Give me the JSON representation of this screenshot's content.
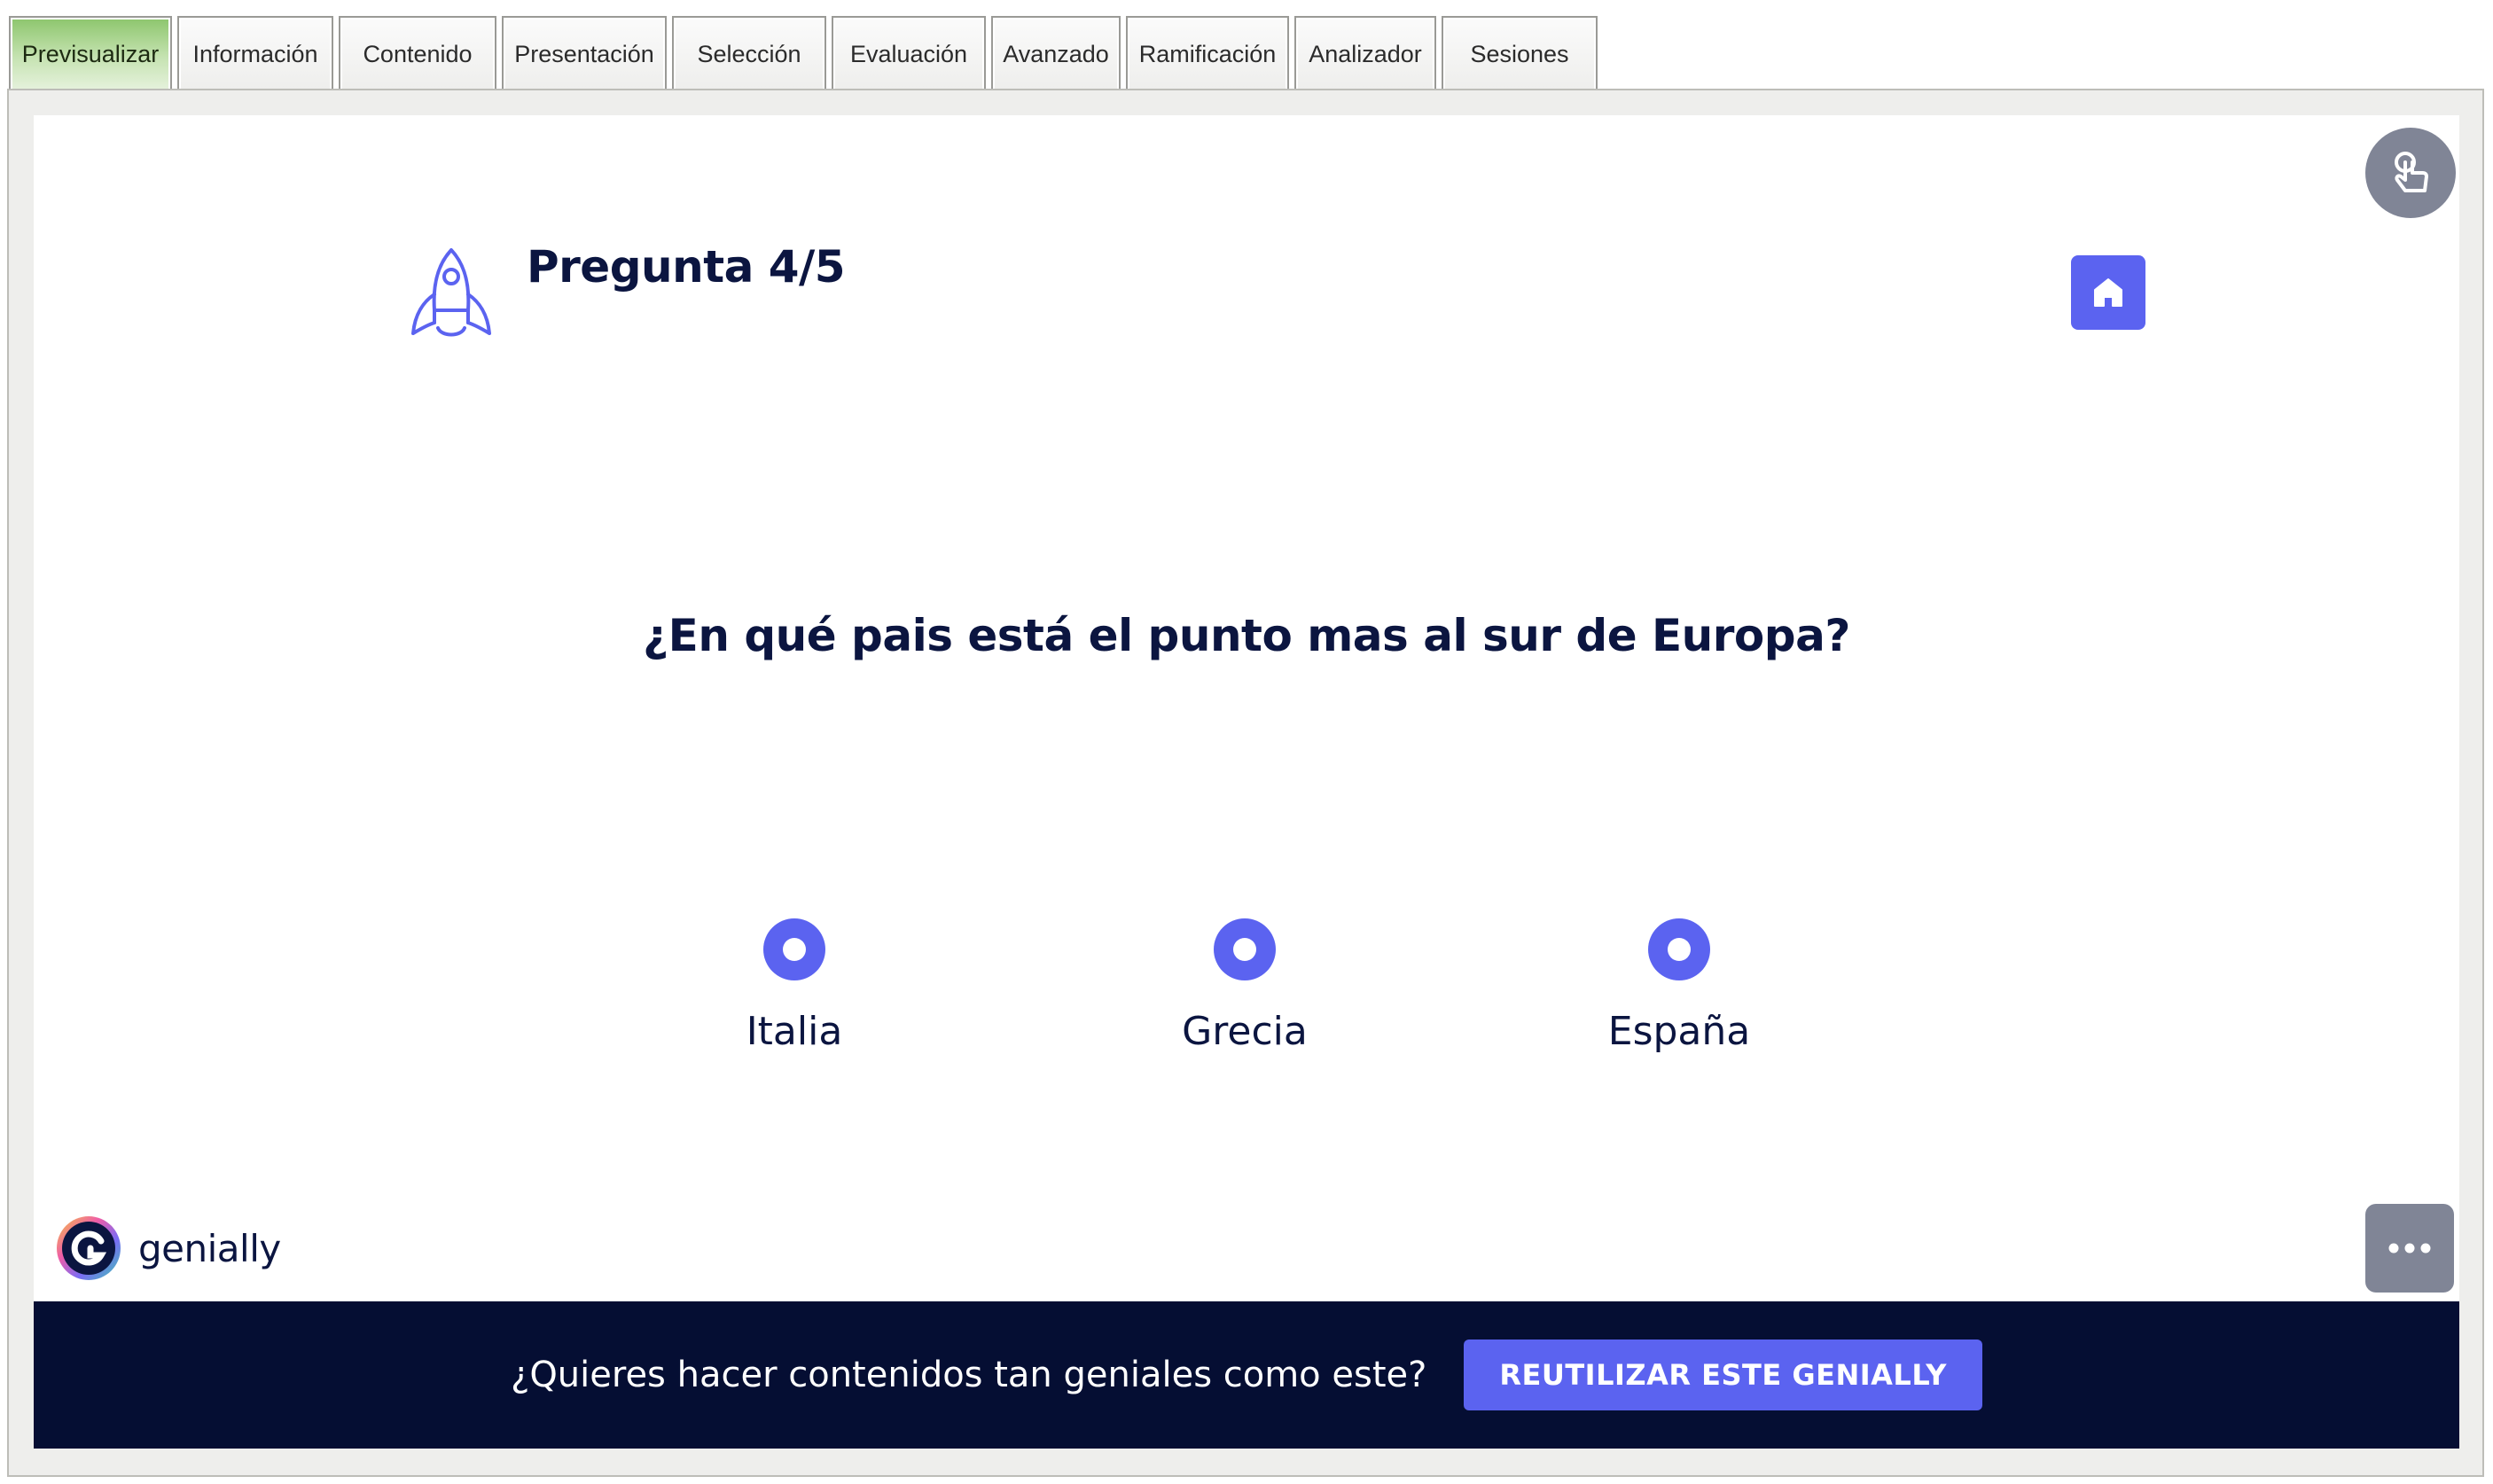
{
  "tabs": [
    {
      "label": "Previsualizar",
      "active": true
    },
    {
      "label": "Información",
      "active": false
    },
    {
      "label": "Contenido",
      "active": false
    },
    {
      "label": "Presentación",
      "active": false
    },
    {
      "label": "Selección",
      "active": false
    },
    {
      "label": "Evaluación",
      "active": false
    },
    {
      "label": "Avanzado",
      "active": false
    },
    {
      "label": "Ramificación",
      "active": false
    },
    {
      "label": "Analizador",
      "active": false
    },
    {
      "label": "Sesiones",
      "active": false
    }
  ],
  "quiz": {
    "counter": "Pregunta 4/5",
    "question": "¿En qué pais está el punto mas al sur de Europa?",
    "answers": [
      {
        "label": "Italia"
      },
      {
        "label": "Grecia"
      },
      {
        "label": "España"
      }
    ]
  },
  "icons": {
    "header": "rocket-icon",
    "home": "home-icon",
    "pointer": "hand-pointer-icon",
    "more": "more-dots-icon"
  },
  "brand": {
    "name": "genially"
  },
  "promo": {
    "text": "¿Quieres hacer contenidos tan geniales como este?",
    "button": "REUTILIZAR ESTE GENIALLY"
  },
  "colors": {
    "accent": "#5b63f0",
    "text_dark": "#0b1540",
    "footer_bg": "#050e33",
    "grey_button": "#808596",
    "active_tab": "#8cc56c"
  }
}
